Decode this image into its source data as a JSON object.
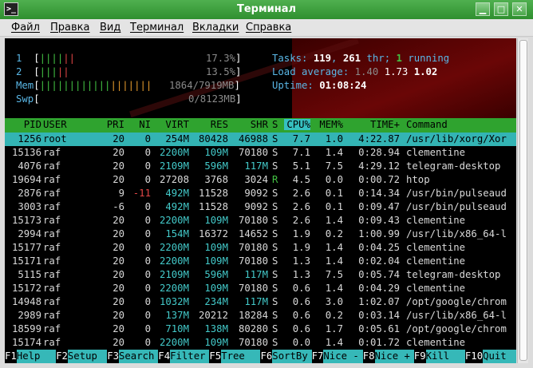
{
  "window": {
    "title": "Терминал",
    "icon": ">_",
    "minimize": "▁",
    "maximize": "□",
    "close": "✕"
  },
  "menu": [
    "Файл",
    "Правка",
    "Вид",
    "Терминал",
    "Вкладки",
    "Справка"
  ],
  "meters": {
    "cpu1": {
      "label": "1",
      "bars": "||||||",
      "value": "17.3%"
    },
    "cpu2": {
      "label": "2",
      "bars": "|||||",
      "value": "13.5%"
    },
    "mem": {
      "label": "Mem",
      "bars_green": "||||||||||||",
      "bars_orange": "|||||||",
      "value": "1864/7919MB"
    },
    "swp": {
      "label": "Swp",
      "value": "0/8123MB"
    }
  },
  "info": {
    "tasks_label": "Tasks:",
    "tasks": "119",
    "thr": "261",
    "thr_label": "thr;",
    "running": "1",
    "running_label": "running",
    "load_label": "Load average:",
    "load1": "1.40",
    "load5": "1.73",
    "load15": "1.02",
    "uptime_label": "Uptime:",
    "uptime": "01:08:24"
  },
  "columns": [
    "PID",
    "USER",
    "PRI",
    "NI",
    "VIRT",
    "RES",
    "SHR",
    "S",
    "CPU%",
    "MEM%",
    "TIME+",
    "Command"
  ],
  "processes": [
    {
      "pid": "1256",
      "user": "root",
      "pri": "20",
      "ni": "0",
      "virt": "254M",
      "res": "80428",
      "shr": "46988",
      "s": "S",
      "cpu": "7.7",
      "mem": "1.0",
      "time": "4:22.87",
      "cmd": "/usr/lib/xorg/Xor"
    },
    {
      "pid": "15136",
      "user": "raf",
      "pri": "20",
      "ni": "0",
      "virt": "2200M",
      "res": "109M",
      "shr": "70180",
      "s": "S",
      "cpu": "7.1",
      "mem": "1.4",
      "time": "0:28.94",
      "cmd": "clementine"
    },
    {
      "pid": "4076",
      "user": "raf",
      "pri": "20",
      "ni": "0",
      "virt": "2109M",
      "res": "596M",
      "shr": "117M",
      "s": "S",
      "cpu": "5.1",
      "mem": "7.5",
      "time": "4:29.12",
      "cmd": "telegram-desktop"
    },
    {
      "pid": "19694",
      "user": "raf",
      "pri": "20",
      "ni": "0",
      "virt": "27208",
      "res": "3768",
      "shr": "3024",
      "s": "R",
      "cpu": "4.5",
      "mem": "0.0",
      "time": "0:00.72",
      "cmd": "htop"
    },
    {
      "pid": "2876",
      "user": "raf",
      "pri": "9",
      "ni": "-11",
      "virt": "492M",
      "res": "11528",
      "shr": "9092",
      "s": "S",
      "cpu": "2.6",
      "mem": "0.1",
      "time": "0:14.34",
      "cmd": "/usr/bin/pulseaud"
    },
    {
      "pid": "3003",
      "user": "raf",
      "pri": "-6",
      "ni": "0",
      "virt": "492M",
      "res": "11528",
      "shr": "9092",
      "s": "S",
      "cpu": "2.6",
      "mem": "0.1",
      "time": "0:09.47",
      "cmd": "/usr/bin/pulseaud"
    },
    {
      "pid": "15173",
      "user": "raf",
      "pri": "20",
      "ni": "0",
      "virt": "2200M",
      "res": "109M",
      "shr": "70180",
      "s": "S",
      "cpu": "2.6",
      "mem": "1.4",
      "time": "0:09.43",
      "cmd": "clementine"
    },
    {
      "pid": "2994",
      "user": "raf",
      "pri": "20",
      "ni": "0",
      "virt": "154M",
      "res": "16372",
      "shr": "14652",
      "s": "S",
      "cpu": "1.9",
      "mem": "0.2",
      "time": "1:00.99",
      "cmd": "/usr/lib/x86_64-l"
    },
    {
      "pid": "15177",
      "user": "raf",
      "pri": "20",
      "ni": "0",
      "virt": "2200M",
      "res": "109M",
      "shr": "70180",
      "s": "S",
      "cpu": "1.9",
      "mem": "1.4",
      "time": "0:04.25",
      "cmd": "clementine"
    },
    {
      "pid": "15171",
      "user": "raf",
      "pri": "20",
      "ni": "0",
      "virt": "2200M",
      "res": "109M",
      "shr": "70180",
      "s": "S",
      "cpu": "1.3",
      "mem": "1.4",
      "time": "0:02.04",
      "cmd": "clementine"
    },
    {
      "pid": "5115",
      "user": "raf",
      "pri": "20",
      "ni": "0",
      "virt": "2109M",
      "res": "596M",
      "shr": "117M",
      "s": "S",
      "cpu": "1.3",
      "mem": "7.5",
      "time": "0:05.74",
      "cmd": "telegram-desktop"
    },
    {
      "pid": "15172",
      "user": "raf",
      "pri": "20",
      "ni": "0",
      "virt": "2200M",
      "res": "109M",
      "shr": "70180",
      "s": "S",
      "cpu": "0.6",
      "mem": "1.4",
      "time": "0:04.29",
      "cmd": "clementine"
    },
    {
      "pid": "14948",
      "user": "raf",
      "pri": "20",
      "ni": "0",
      "virt": "1032M",
      "res": "234M",
      "shr": "117M",
      "s": "S",
      "cpu": "0.6",
      "mem": "3.0",
      "time": "1:02.07",
      "cmd": "/opt/google/chrom"
    },
    {
      "pid": "2989",
      "user": "raf",
      "pri": "20",
      "ni": "0",
      "virt": "137M",
      "res": "20212",
      "shr": "18284",
      "s": "S",
      "cpu": "0.6",
      "mem": "0.2",
      "time": "0:03.14",
      "cmd": "/usr/lib/x86_64-l"
    },
    {
      "pid": "18599",
      "user": "raf",
      "pri": "20",
      "ni": "0",
      "virt": "710M",
      "res": "138M",
      "shr": "80280",
      "s": "S",
      "cpu": "0.6",
      "mem": "1.7",
      "time": "0:05.61",
      "cmd": "/opt/google/chrom"
    },
    {
      "pid": "15174",
      "user": "raf",
      "pri": "20",
      "ni": "0",
      "virt": "2200M",
      "res": "109M",
      "shr": "70180",
      "s": "S",
      "cpu": "0.0",
      "mem": "1.4",
      "time": "0:01.72",
      "cmd": "clementine"
    }
  ],
  "fkeys": [
    {
      "key": "F1",
      "label": "Help  "
    },
    {
      "key": "F2",
      "label": "Setup "
    },
    {
      "key": "F3",
      "label": "Search"
    },
    {
      "key": "F4",
      "label": "Filter"
    },
    {
      "key": "F5",
      "label": "Tree  "
    },
    {
      "key": "F6",
      "label": "SortBy"
    },
    {
      "key": "F7",
      "label": "Nice -"
    },
    {
      "key": "F8",
      "label": "Nice +"
    },
    {
      "key": "F9",
      "label": "Kill  "
    },
    {
      "key": "F10",
      "label": "Quit"
    }
  ],
  "colors": {
    "titlebar": "#3a9e3a",
    "header": "#2fa32f",
    "selected": "#33b4b4",
    "terminal_bg": "#000000"
  }
}
